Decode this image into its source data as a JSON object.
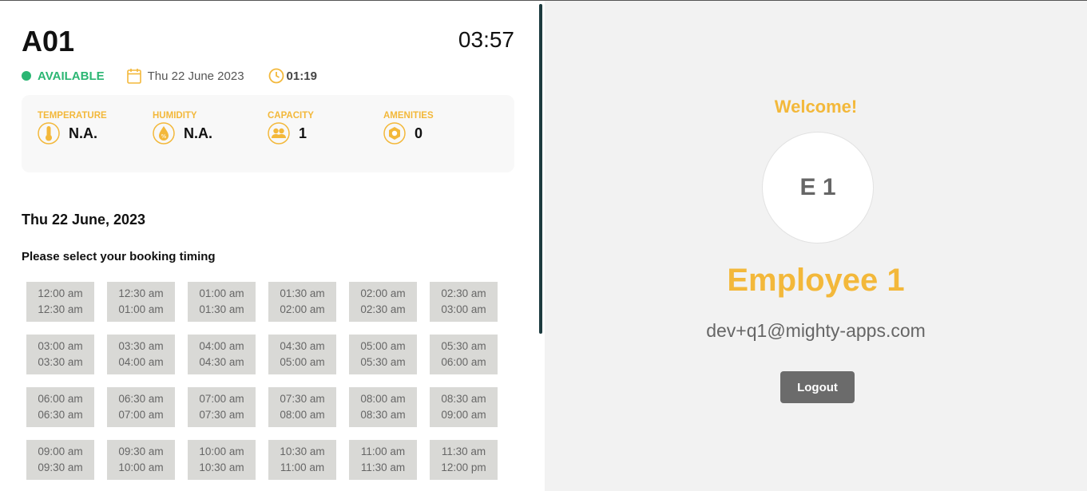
{
  "room": {
    "id": "A01",
    "clock": "03:57",
    "status": "AVAILABLE",
    "status_color": "#2bb673",
    "date": "Thu 22 June 2023",
    "timer": "01:19"
  },
  "stats": [
    {
      "label": "TEMPERATURE",
      "value": "N.A.",
      "icon": "thermometer-icon"
    },
    {
      "label": "HUMIDITY",
      "value": "N.A.",
      "icon": "humidity-icon"
    },
    {
      "label": "CAPACITY",
      "value": "1",
      "icon": "people-icon"
    },
    {
      "label": "AMENITIES",
      "value": "0",
      "icon": "amenities-icon"
    }
  ],
  "booking": {
    "date_heading": "Thu 22 June, 2023",
    "prompt": "Please select your booking timing",
    "slots": [
      {
        "start": "12:00 am",
        "end": "12:30 am"
      },
      {
        "start": "12:30 am",
        "end": "01:00 am"
      },
      {
        "start": "01:00 am",
        "end": "01:30 am"
      },
      {
        "start": "01:30 am",
        "end": "02:00 am"
      },
      {
        "start": "02:00 am",
        "end": "02:30 am"
      },
      {
        "start": "02:30 am",
        "end": "03:00 am"
      },
      {
        "start": "03:00 am",
        "end": "03:30 am"
      },
      {
        "start": "03:30 am",
        "end": "04:00 am"
      },
      {
        "start": "04:00 am",
        "end": "04:30 am"
      },
      {
        "start": "04:30 am",
        "end": "05:00 am"
      },
      {
        "start": "05:00 am",
        "end": "05:30 am"
      },
      {
        "start": "05:30 am",
        "end": "06:00 am"
      },
      {
        "start": "06:00 am",
        "end": "06:30 am"
      },
      {
        "start": "06:30 am",
        "end": "07:00 am"
      },
      {
        "start": "07:00 am",
        "end": "07:30 am"
      },
      {
        "start": "07:30 am",
        "end": "08:00 am"
      },
      {
        "start": "08:00 am",
        "end": "08:30 am"
      },
      {
        "start": "08:30 am",
        "end": "09:00 am"
      },
      {
        "start": "09:00 am",
        "end": "09:30 am"
      },
      {
        "start": "09:30 am",
        "end": "10:00 am"
      },
      {
        "start": "10:00 am",
        "end": "10:30 am"
      },
      {
        "start": "10:30 am",
        "end": "11:00 am"
      },
      {
        "start": "11:00 am",
        "end": "11:30 am"
      },
      {
        "start": "11:30 am",
        "end": "12:00 pm"
      }
    ]
  },
  "user": {
    "welcome": "Welcome!",
    "initials": "E 1",
    "name": "Employee 1",
    "email": "dev+q1@mighty-apps.com",
    "logout_label": "Logout"
  },
  "colors": {
    "accent": "#f3b83a",
    "available": "#2bb673",
    "slot_bg": "#d9d9d6",
    "logout_bg": "#6b6b6b"
  }
}
